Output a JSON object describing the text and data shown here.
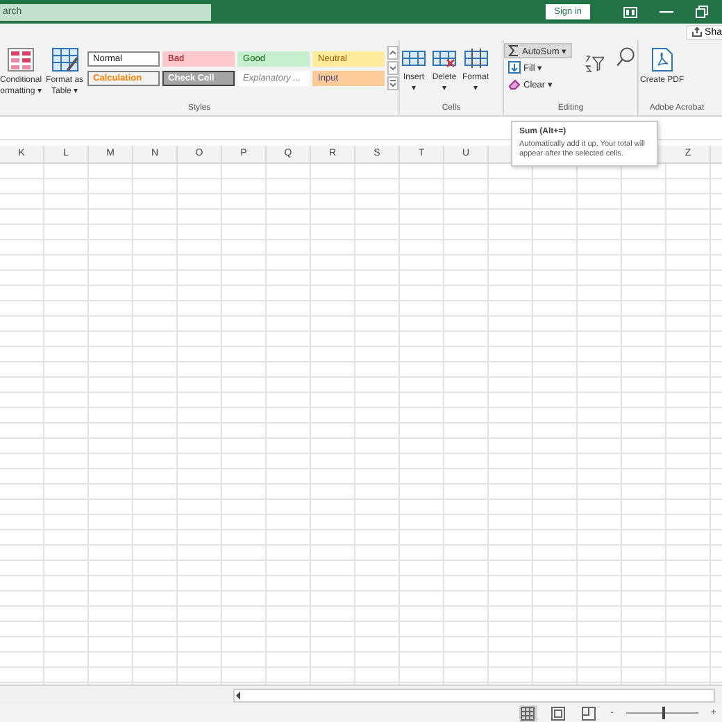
{
  "title_bar": {
    "search": {
      "placeholder": "arch"
    },
    "sign_in": "Sign in"
  },
  "share": "Sha",
  "ribbon": {
    "groups": [
      {
        "label": "Styles",
        "kind": "styles",
        "buttons": [
          {
            "lines": [
              "Conditional",
              "ormatting"
            ],
            "caret": "▾"
          },
          {
            "lines": [
              "Format as",
              "Table"
            ],
            "caret": "▾"
          }
        ],
        "gallery": [
          {
            "label": "Normal",
            "color": "#ffffff",
            "selected": true
          },
          {
            "label": "Bad",
            "color": "#ffc7ce",
            "selected": false
          },
          {
            "label": "Good",
            "color": "#c6efce",
            "selected": false
          },
          {
            "label": "Neutral",
            "color": "#ffeb9c",
            "selected": false
          },
          {
            "label": "Calculation",
            "color": "#f2f2f2",
            "selected": false
          },
          {
            "label": "Check Cell",
            "color": "#a5a5a5",
            "selected": false
          },
          {
            "label": "Explanatory ...",
            "color": "#ffffff",
            "selected": false
          },
          {
            "label": "Input",
            "color": "#ffcc99",
            "selected": false
          }
        ]
      },
      {
        "label": "Cells",
        "kind": "cells",
        "buttons": [
          {
            "label": "Insert",
            "caret": "▾"
          },
          {
            "label": "Delete",
            "caret": "▾"
          },
          {
            "label": "Format",
            "caret": "▾"
          }
        ]
      },
      {
        "label": "Editing",
        "kind": "editing",
        "small": [
          {
            "label": "AutoSum",
            "caret": "▾",
            "selected": true
          },
          {
            "label": "Fill",
            "caret": "▾",
            "selected": false
          },
          {
            "label": "Clear",
            "caret": "▾",
            "selected": false
          }
        ]
      },
      {
        "label": "Adobe Acrobat",
        "kind": "acrobat",
        "buttons": [
          {
            "label": "Create PDF"
          }
        ]
      }
    ]
  },
  "tooltip": {
    "title": "Sum (Alt+=)",
    "text": "Automatically add it up. Your total will appear after the selected cells."
  },
  "columns": [
    "K",
    "L",
    "M",
    "N",
    "O",
    "P",
    "Q",
    "R",
    "S",
    "T",
    "U",
    "Z"
  ],
  "status_bar": {
    "views": [
      {
        "kind": "normal",
        "selected": true
      },
      {
        "kind": "layout",
        "selected": false
      },
      {
        "kind": "break",
        "selected": false
      }
    ],
    "zoom_minus": "-",
    "zoom_plus": "+",
    "zoom": {
      "level": 0.52
    }
  }
}
